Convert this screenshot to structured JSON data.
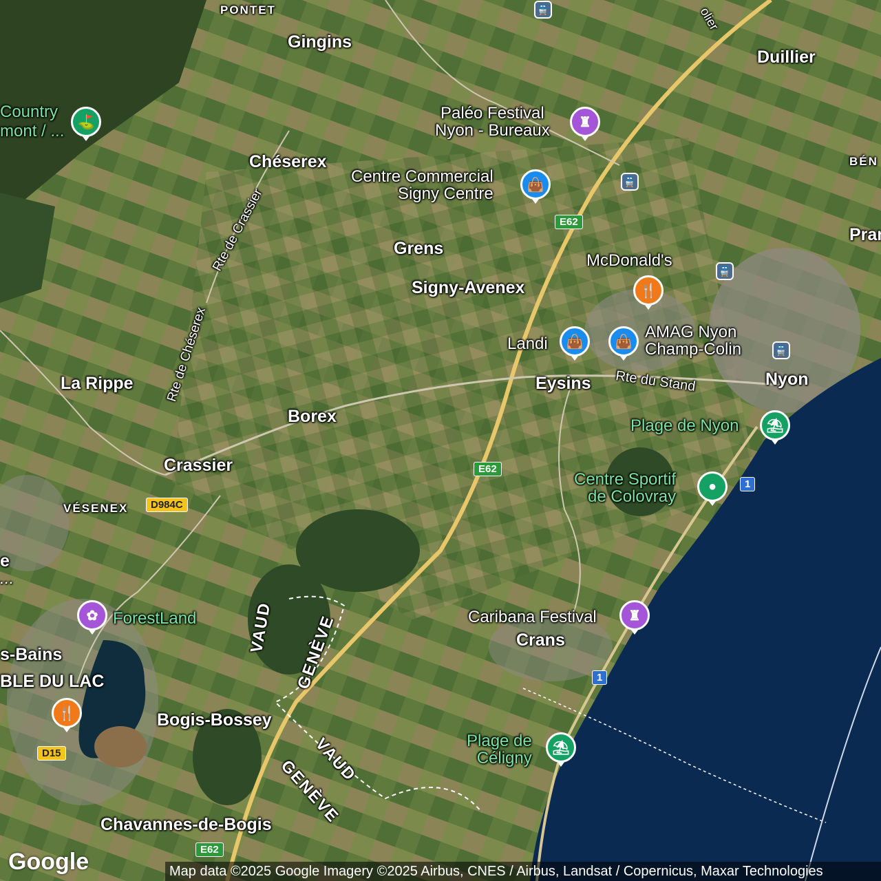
{
  "map": {
    "places": {
      "pontet": "PONTET",
      "gingins": "Gingins",
      "duillier": "Duillier",
      "country": "Country",
      "country2": "mont / ...",
      "cheserex": "Chéserex",
      "grens": "Grens",
      "signy_avenex": "Signy-Avenex",
      "la_rippe": "La Rippe",
      "borex": "Borex",
      "eysins": "Eysins",
      "nyon": "Nyon",
      "crassier": "Crassier",
      "vesenex": "VÉSENEX",
      "crans": "Crans",
      "bogis_bossey": "Bogis-Bossey",
      "chavannes": "Chavannes-de-Bogis",
      "benex": "BÉN",
      "prangins": "Pran",
      "bains": "s-Bains",
      "table_du_lac": "BLE DU LAC",
      "e_frag": "e",
      "dots_frag": "..."
    },
    "roads": {
      "rte_de_crassier": "Rte de Crassier",
      "rte_de_cheserex": "Rte de Chéserex",
      "rte_du_stand": "Rte du Stand",
      "olier": "olier"
    },
    "regions": {
      "vaud1": "VAUD",
      "geneve1": "GENÈVE",
      "vaud2": "VAUD",
      "geneve2": "GENÈVE"
    },
    "pois": {
      "paleo": "Paléo Festival\nNyon - Bureaux",
      "signy_centre": "Centre Commercial\nSigny Centre",
      "mcdonalds": "McDonald's",
      "landi": "Landi",
      "amag": "AMAG Nyon\nChamp-Colin",
      "plage_nyon": "Plage de Nyon",
      "colovray": "Centre Sportif\nde Colovray",
      "caribana": "Caribana Festival",
      "forestland": "ForestLand",
      "plage_celigny": "Plage de\nCéligny"
    },
    "shields": {
      "e62_a": "E62",
      "e62_b": "E62",
      "e62_c": "E62",
      "d984c": "D984C",
      "d15": "D15",
      "route1_a": "1",
      "route1_b": "1"
    },
    "icons": {
      "shopping": "shopping-bag-icon",
      "restaurant": "restaurant-icon",
      "festival": "castle-icon",
      "beach": "beach-umbrella-icon",
      "train": "train-station-icon",
      "golf": "golf-icon",
      "sport": "stadium-icon",
      "park": "amusement-park-icon"
    }
  },
  "footer": {
    "google_logo": "Google",
    "attribution": "Map data ©2025 Google Imagery ©2025 Airbus, CNES / Airbus, Landsat / Copernicus, Maxar Technologies"
  },
  "colors": {
    "lake": "#0b2a52",
    "fields": "#5d7a3c",
    "forest": "#2e4a22",
    "motorway": "#e8c76a",
    "poi_blue": "#1a8cf0",
    "poi_orange": "#f07a1a",
    "poi_purple": "#a455d8",
    "poi_green": "#15a064"
  }
}
